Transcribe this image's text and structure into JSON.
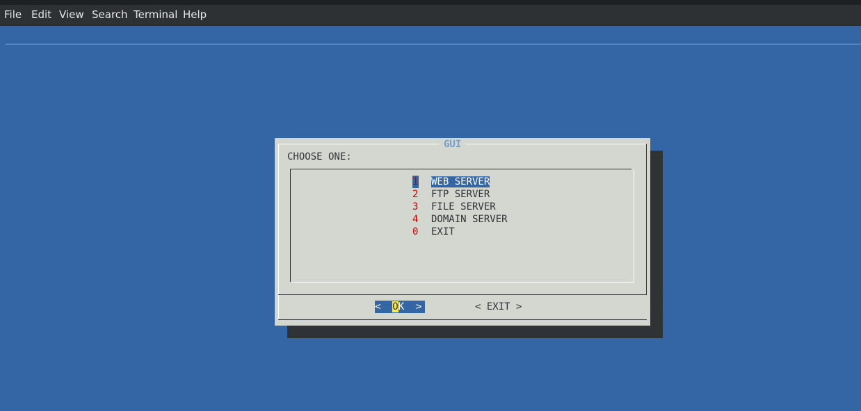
{
  "menubar": {
    "items": [
      "File",
      "Edit",
      "View",
      "Search",
      "Terminal",
      "Help"
    ]
  },
  "dialog": {
    "title": "GUI",
    "prompt": "CHOOSE ONE:",
    "options": [
      {
        "tag": "1",
        "label": "WEB SERVER",
        "selected": true
      },
      {
        "tag": "2",
        "label": "FTP SERVER",
        "selected": false
      },
      {
        "tag": "3",
        "label": "FILE SERVER",
        "selected": false
      },
      {
        "tag": "4",
        "label": "DOMAIN SERVER",
        "selected": false
      },
      {
        "tag": "0",
        "label": "EXIT",
        "selected": false
      }
    ],
    "ok_button": {
      "left": "<",
      "hotkey": "O",
      "rest": "K",
      "right": ">"
    },
    "exit_button": "< EXIT >"
  },
  "colors": {
    "terminal_bg": "#3465a4",
    "dialog_bg": "#d3d7cf",
    "tag_color": "#cc0000",
    "title_color": "#729fcf",
    "hotkey_bg": "#fce94f"
  }
}
